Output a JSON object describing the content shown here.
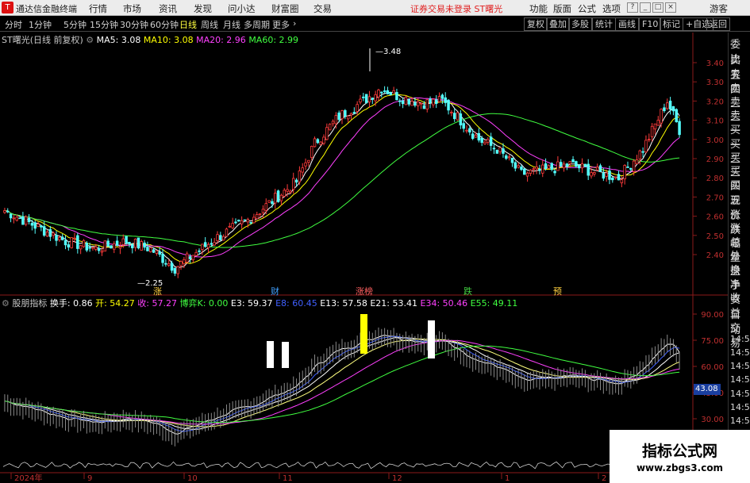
{
  "menubar": {
    "logo": "T",
    "app_name": "通达信金融终端",
    "menus": [
      "行情",
      "市场",
      "资讯",
      "发现",
      "问小达",
      "财富圈",
      "交易"
    ],
    "notice": "证券交易未登录  ST曙光",
    "right_menus": [
      "功能",
      "版面",
      "公式",
      "选项"
    ],
    "user": "游客"
  },
  "toolbar": {
    "timeframes": [
      "分时",
      "1分钟",
      "5分钟",
      "15分钟",
      "30分钟",
      "60分钟",
      "日线",
      "周线",
      "月线",
      "多周期",
      "更多"
    ],
    "active": "日线",
    "right_buttons": [
      "复权",
      "叠加",
      "多股",
      "统计",
      "画线",
      "F10",
      "标记",
      "+自选",
      "返回"
    ]
  },
  "main_chart": {
    "stock_name": "ST曙光(日线 前复权)",
    "ma": [
      {
        "label": "MA5: 3.08",
        "color": "#ffffff"
      },
      {
        "label": "MA10: 3.08",
        "color": "#ffff00"
      },
      {
        "label": "MA20: 2.96",
        "color": "#ff40ff"
      },
      {
        "label": "MA60: 2.99",
        "color": "#40ff40"
      }
    ],
    "high_label": "3.48",
    "low_label": "2.25",
    "price_ticks": [
      "3.40",
      "3.30",
      "3.20",
      "3.10",
      "3.00",
      "2.90",
      "2.80",
      "2.70",
      "2.60",
      "2.50",
      "2.40"
    ],
    "price_tick_values": [
      3.4,
      3.3,
      3.2,
      3.1,
      3.0,
      2.9,
      2.8,
      2.7,
      2.6,
      2.5,
      2.4
    ],
    "event_badges": [
      {
        "text": "涨",
        "color": "#ffd040"
      },
      {
        "text": "财",
        "color": "#40a0ff"
      },
      {
        "text": "涨榜",
        "color": "#ff6060"
      },
      {
        "text": "跌",
        "color": "#40d040"
      },
      {
        "text": "预",
        "color": "#ffd040"
      }
    ]
  },
  "indicator": {
    "name": "股朋指标",
    "values": [
      {
        "label": "换手: 0.86",
        "color": "#ffffff"
      },
      {
        "label": "开: 54.27",
        "color": "#ffff00"
      },
      {
        "label": "收: 57.27",
        "color": "#ff40ff"
      },
      {
        "label": "博弈K: 0.00",
        "color": "#40ff40"
      },
      {
        "label": "E3: 59.37",
        "color": "#ffffff"
      },
      {
        "label": "E8: 60.45",
        "color": "#4040ff"
      },
      {
        "label": "E13: 57.58",
        "color": "#ffffff"
      },
      {
        "label": "E21: 53.41",
        "color": "#ffffff"
      },
      {
        "label": "E34: 50.46",
        "color": "#ff40ff"
      },
      {
        "label": "E55: 49.11",
        "color": "#40ff40"
      }
    ],
    "ticks": [
      "90.00",
      "75.00",
      "60.00",
      "45.00",
      "30.00"
    ],
    "tick_values": [
      90,
      75,
      60,
      45,
      30
    ],
    "current_value": "43.08"
  },
  "date_axis": [
    "2024年",
    "9",
    "10",
    "11",
    "12",
    "1",
    "2"
  ],
  "side_panel": {
    "top_items": [
      "委比",
      "卖五",
      "卖四",
      "卖三",
      "卖二",
      "卖一",
      "买一",
      "买二",
      "买三",
      "买四",
      "买五",
      "现价",
      "涨跌",
      "涨幅",
      "总量",
      "外盘",
      "换手",
      "净资",
      "收益"
    ],
    "bottom_items": [
      "自动",
      "交易"
    ],
    "times": [
      "14:53",
      "14:53",
      "14:54",
      "14:55",
      "14:55",
      "14:56",
      "14:56"
    ]
  },
  "watermark": {
    "line1": "指标公式网",
    "line2": "www.zbgs3.com"
  }
}
